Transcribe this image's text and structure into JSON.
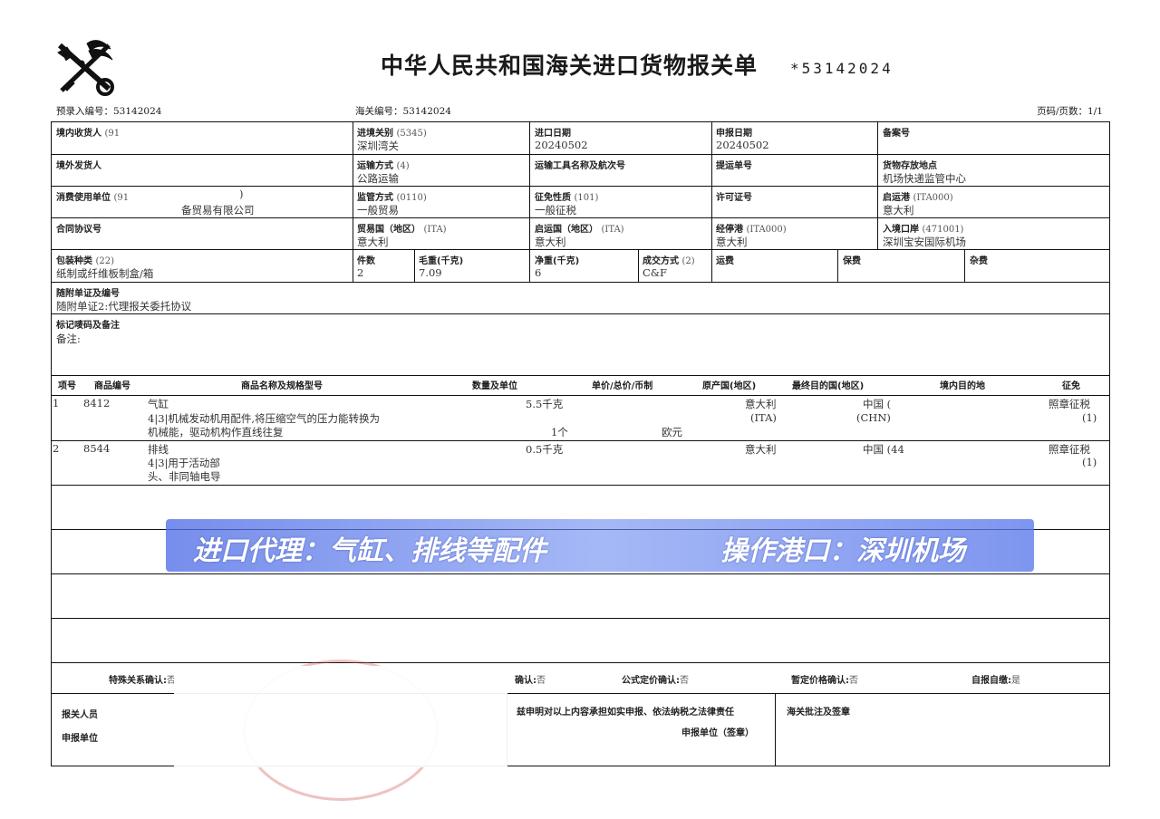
{
  "header": {
    "title": "中华人民共和国海关进口货物报关单",
    "barcode_text": "*53142024",
    "pre_entry_no": "预录入编号：53142024",
    "customs_no": "海关编号：53142024",
    "page_info": "页码/页数：1/1"
  },
  "row1": {
    "consignee_label": "境内收货人",
    "consignee_code": "(91",
    "entry_port_label": "进境关别",
    "entry_port_code": "(5345)",
    "entry_port_value": "深圳湾关",
    "import_date_label": "进口日期",
    "import_date_value": "20240502",
    "declare_date_label": "申报日期",
    "declare_date_value": "20240502",
    "record_no_label": "备案号"
  },
  "row2": {
    "shipper_label": "境外发货人",
    "transport_mode_label": "运输方式",
    "transport_mode_code": "(4)",
    "transport_mode_value": "公路运输",
    "vehicle_label": "运输工具名称及航次号",
    "bill_label": "提运单号",
    "storage_label": "货物存放地点",
    "storage_value": "机场快递监管中心"
  },
  "row3": {
    "consumer_label": "消费使用单位",
    "consumer_code": "(91",
    "consumer_paren": ")",
    "consumer_name": "备贸易有限公司",
    "supervision_label": "监管方式",
    "supervision_code": "(0110)",
    "supervision_value": "一般贸易",
    "levy_label": "征免性质",
    "levy_code": "(101)",
    "levy_value": "一般征税",
    "license_label": "许可证号",
    "departure_port_label": "启运港",
    "departure_port_code": "(ITA000)",
    "departure_port_value": "意大利"
  },
  "row4": {
    "contract_label": "合同协议号",
    "trade_country_label": "贸易国（地区）",
    "trade_country_code": "(ITA)",
    "trade_country_value": "意大利",
    "origin_country_label": "启运国（地区）",
    "origin_country_code": "(ITA)",
    "origin_country_value": "意大利",
    "stop_port_label": "经停港",
    "stop_port_code": "(ITA000)",
    "stop_port_value": "意大利",
    "entry_port_label": "入境口岸",
    "entry_port_code": "(471001)",
    "entry_port_value": "深圳宝安国际机场"
  },
  "row5": {
    "package_label": "包装种类",
    "package_code": "(22)",
    "package_value": "纸制或纤维板制盒/箱",
    "pieces_label": "件数",
    "pieces_value": "2",
    "gross_label": "毛重(千克)",
    "gross_value": "7.09",
    "net_label": "净重(千克)",
    "net_value": "6",
    "deal_label": "成交方式",
    "deal_code": "(2)",
    "deal_value": "C&F",
    "freight_label": "运费",
    "insurance_label": "保费",
    "misc_label": "杂费"
  },
  "docs": {
    "label": "随附单证及编号",
    "value": "随附单证2:代理报关委托协议"
  },
  "marks": {
    "label": "标记唛码及备注",
    "remarks": "备注:"
  },
  "goods": {
    "columns": [
      "项号",
      "商品编号",
      "商品名称及规格型号",
      "数量及单位",
      "单价/总价/币制",
      "原产国(地区)",
      "最终目的国(地区)",
      "境内目的地",
      "征免"
    ],
    "rows": [
      {
        "no": "1",
        "hs": "8412",
        "name": "气缸",
        "spec1": "4|3|机械发动机用配件,将压缩空气的压力能转换为",
        "spec2": "机械能，驱动机构作直线往复",
        "qty": "5.5千克",
        "qty2": "1个",
        "currency": "欧元",
        "origin": "意大利",
        "origin_code": "(ITA)",
        "dest": "中国 (",
        "dest_code": "(CHN)",
        "levy": "照章征税",
        "levy_code": "(1)"
      },
      {
        "no": "2",
        "hs": "8544",
        "name": "排线",
        "spec1": "4|3|用于活动部",
        "spec2": "头、非同轴电导",
        "qty": "0.5千克",
        "origin": "意大利",
        "dest": "中国 (44",
        "levy": "照章征税",
        "levy_code": "(1)"
      }
    ]
  },
  "banner": {
    "left": "进口代理：气缸、排线等配件",
    "right": "操作港口：深圳机场"
  },
  "confirm": {
    "special_label": "特殊关系确认:",
    "special_value": "否",
    "price_label": "确认:",
    "price_value": "否",
    "formula_label": "公式定价确认:",
    "formula_value": "否",
    "provisional_label": "暂定价格确认:",
    "provisional_value": "否",
    "self_label": "自报自缴:",
    "self_value": "是"
  },
  "footer": {
    "declarant_label": "报关人员",
    "unit_label": "申报单位",
    "statement": "兹申明对以上内容承担如实申报、依法纳税之法律责任",
    "seal_label": "申报单位（签章）",
    "customs_label": "海关批注及签章"
  }
}
